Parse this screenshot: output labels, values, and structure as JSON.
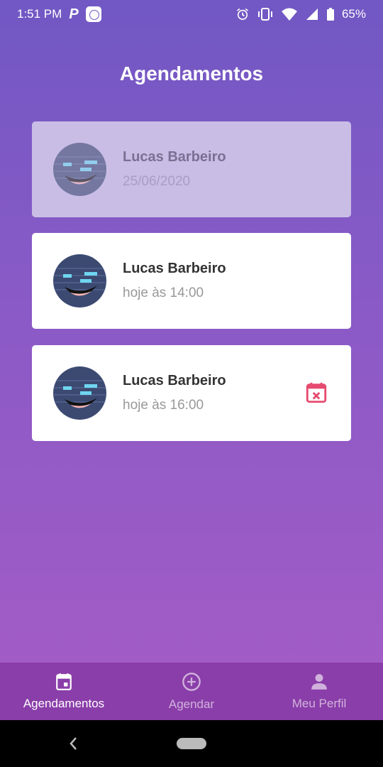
{
  "status_bar": {
    "time": "1:51 PM",
    "battery": "65%"
  },
  "header": {
    "title": "Agendamentos"
  },
  "appointments": [
    {
      "name": "Lucas Barbeiro",
      "time": "25/06/2020",
      "state": "past"
    },
    {
      "name": "Lucas Barbeiro",
      "time": "hoje às 14:00",
      "state": "upcoming"
    },
    {
      "name": "Lucas Barbeiro",
      "time": "hoje às 16:00",
      "state": "upcoming",
      "cancel_icon": "calendar-remove-icon"
    }
  ],
  "bottom_nav": {
    "items": [
      {
        "label": "Agendamentos",
        "icon": "calendar-icon",
        "active": true
      },
      {
        "label": "Agendar",
        "icon": "plus-circle-icon",
        "active": false
      },
      {
        "label": "Meu Perfil",
        "icon": "person-icon",
        "active": false
      }
    ]
  },
  "colors": {
    "gradient_top": "#7158c4",
    "gradient_bottom": "#a85cc6",
    "cancel_icon": "#e64a6f",
    "nav_bg": "#8a3ea9"
  }
}
